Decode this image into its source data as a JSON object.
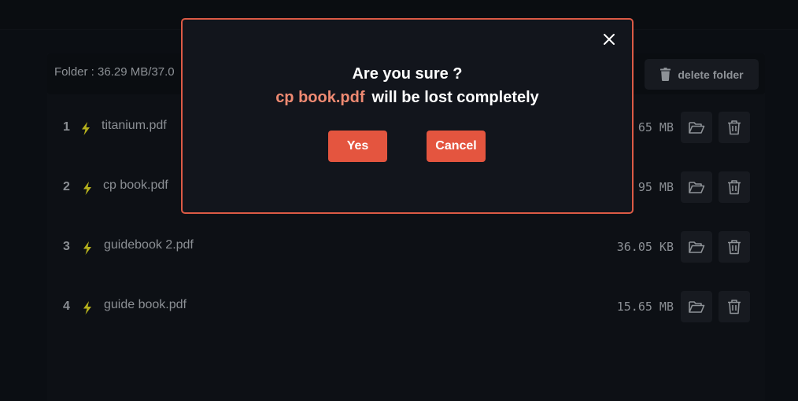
{
  "folder": {
    "info": "Folder : 36.29 MB/37.0",
    "delete_label": "delete folder"
  },
  "files": [
    {
      "index": "1",
      "name": "titanium.pdf",
      "size": "65 MB"
    },
    {
      "index": "2",
      "name": "cp book.pdf",
      "size": "95 MB"
    },
    {
      "index": "3",
      "name": "guidebook 2.pdf",
      "size": "36.05 KB"
    },
    {
      "index": "4",
      "name": "guide book.pdf",
      "size": "15.65 MB"
    }
  ],
  "dialog": {
    "title": "Are you sure ?",
    "filename": "cp book.pdf",
    "message": "will be lost completely",
    "yes_label": "Yes",
    "cancel_label": "Cancel"
  },
  "colors": {
    "accent": "#e4553f",
    "filename_highlight": "#ef8a72",
    "bolt": "#b5b01c"
  },
  "icons": {
    "close": "close-icon",
    "trash": "trash-icon",
    "folder_open": "folder-open-icon",
    "bolt": "lightning-bolt-icon"
  }
}
